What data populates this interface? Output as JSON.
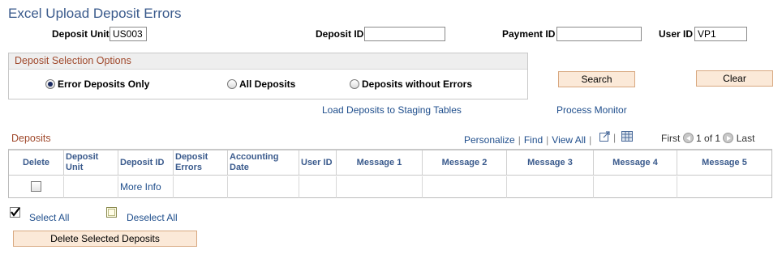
{
  "page": {
    "title": "Excel Upload Deposit Errors"
  },
  "criteria": {
    "deposit_unit_label": "Deposit Unit",
    "deposit_unit_value": "US003",
    "deposit_id_label": "Deposit ID",
    "deposit_id_value": "",
    "payment_id_label": "Payment ID",
    "payment_id_value": "",
    "user_id_label": "User ID",
    "user_id_value": "VP1"
  },
  "selection_options": {
    "title": "Deposit Selection Options",
    "options": [
      {
        "label": "Error Deposits Only",
        "selected": true
      },
      {
        "label": "All Deposits",
        "selected": false
      },
      {
        "label": "Deposits without Errors",
        "selected": false
      }
    ]
  },
  "buttons": {
    "search": "Search",
    "clear": "Clear",
    "delete_selected": "Delete Selected Deposits"
  },
  "links": {
    "load_staging": "Load Deposits to Staging Tables",
    "process_monitor": "Process Monitor"
  },
  "grid": {
    "title": "Deposits",
    "tools": {
      "personalize": "Personalize",
      "find": "Find",
      "view_all": "View All"
    },
    "nav": {
      "first": "First",
      "range": "1 of 1",
      "last": "Last"
    },
    "columns": [
      "Delete",
      "Deposit Unit",
      "Deposit ID",
      "Deposit Errors",
      "Accounting Date",
      "User ID",
      "Message 1",
      "Message 2",
      "Message 3",
      "Message 4",
      "Message 5"
    ],
    "rows": [
      {
        "delete": false,
        "deposit_unit": "",
        "deposit_id": "More Info",
        "deposit_errors": "",
        "accounting_date": "",
        "user_id": "",
        "message_1": "",
        "message_2": "",
        "message_3": "",
        "message_4": "",
        "message_5": ""
      }
    ]
  },
  "select_links": {
    "select_all": "Select All",
    "deselect_all": "Deselect All"
  },
  "icons": [
    "radio-selected-icon",
    "radio-unselected-icon",
    "new-window-icon",
    "download-grid-icon",
    "previous-arrow-icon",
    "next-arrow-icon",
    "checkmark-icon",
    "empty-checkbox-icon"
  ],
  "colors": {
    "title": "#3a5a8c",
    "section_header": "#a0492c",
    "link": "#1f4e8c",
    "button_bg": "#fbe9d8"
  }
}
